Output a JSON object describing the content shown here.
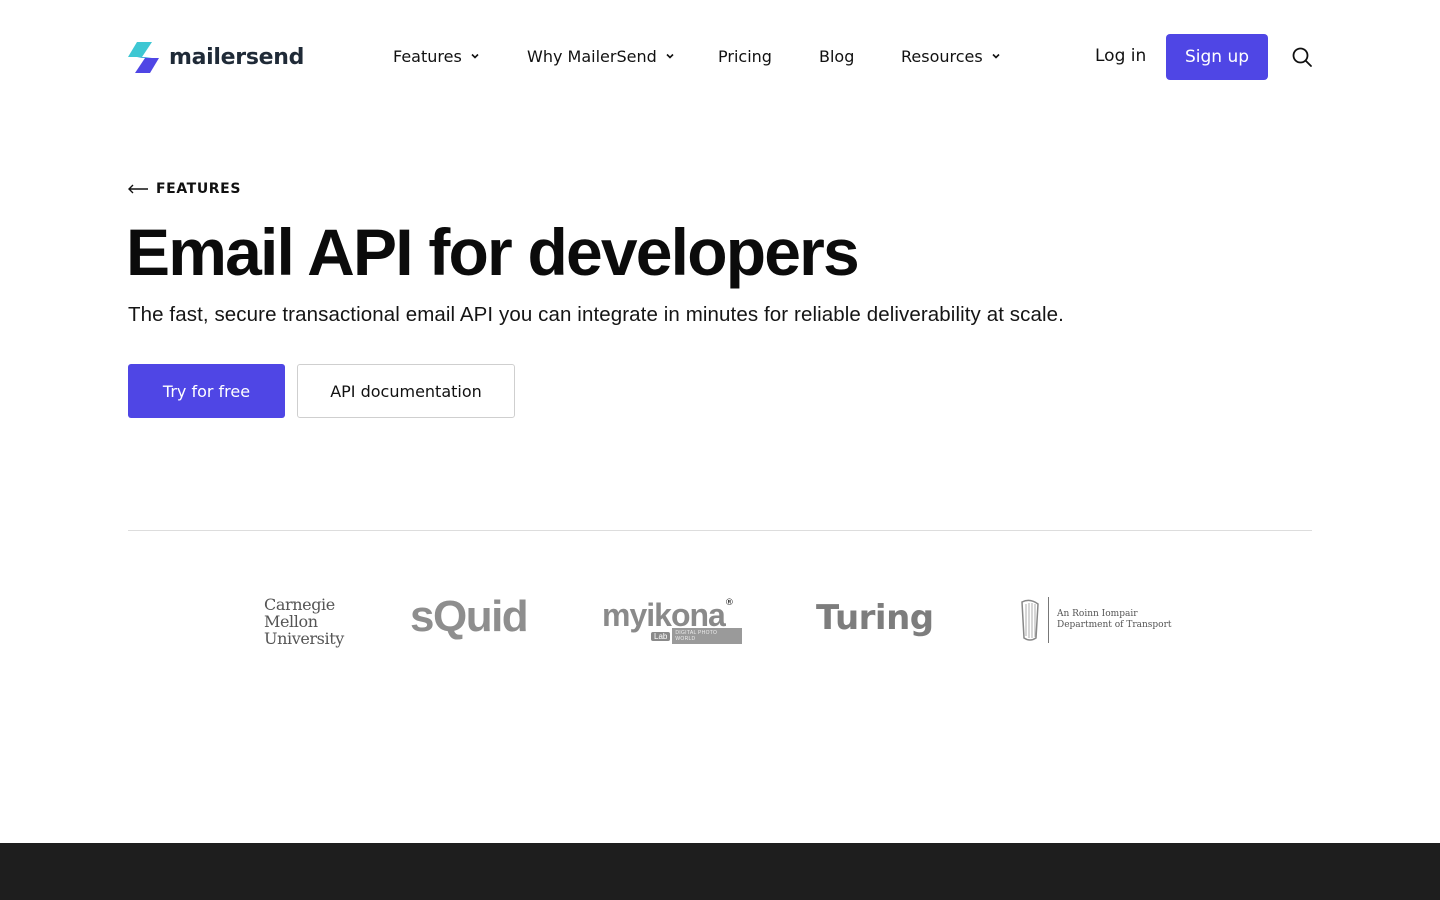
{
  "brand": {
    "name": "mailersend",
    "accent": "#4f46e5"
  },
  "nav": {
    "items": [
      {
        "label": "Features",
        "has_dropdown": true
      },
      {
        "label": "Why MailerSend",
        "has_dropdown": true
      },
      {
        "label": "Pricing",
        "has_dropdown": false
      },
      {
        "label": "Blog",
        "has_dropdown": false
      },
      {
        "label": "Resources",
        "has_dropdown": true
      }
    ],
    "login_label": "Log in",
    "signup_label": "Sign up",
    "search_icon": "search-icon"
  },
  "hero": {
    "breadcrumb": "FEATURES",
    "title": "Email API for developers",
    "subtitle": "The fast, secure transactional email API you can integrate in minutes for reliable deliverability at scale.",
    "primary_cta": "Try for free",
    "secondary_cta": "API documentation"
  },
  "logos": {
    "cmu": [
      "Carnegie",
      "Mellon",
      "University"
    ],
    "squid": "sQuid",
    "myikona": {
      "word": "myikona",
      "lab": "Lab",
      "tagline": "DIGITAL PHOTO WORLD"
    },
    "turing": "Turing",
    "dot": [
      "An Roinn Iompair",
      "Department of Transport"
    ]
  },
  "colors": {
    "footer_band": "#1e1e1e",
    "divider": "#dddddd"
  }
}
